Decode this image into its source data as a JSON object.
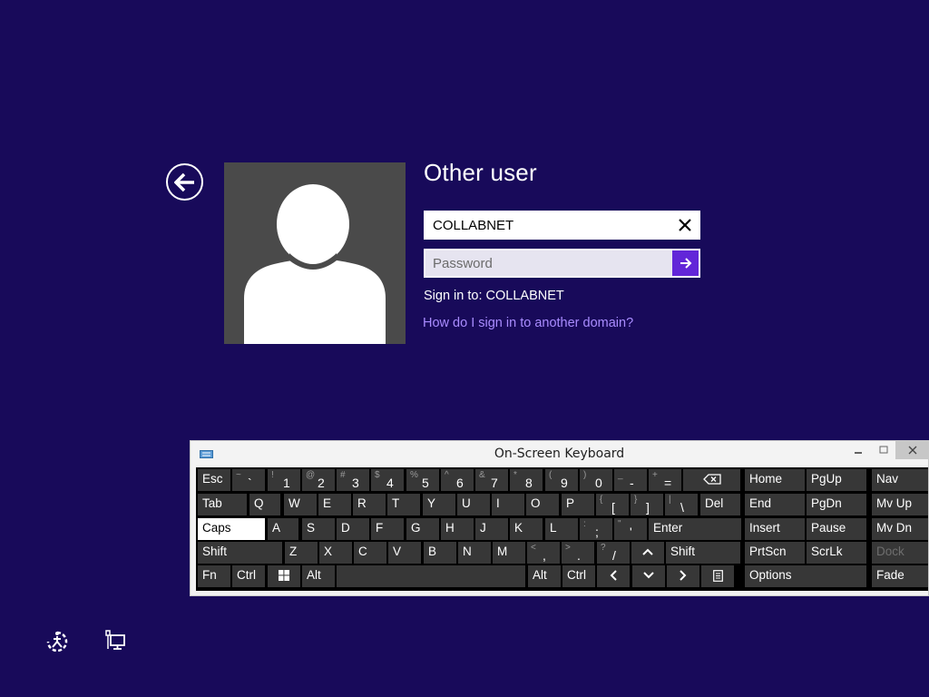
{
  "login": {
    "title": "Other user",
    "username_value": "COLLABNET",
    "password_placeholder": "Password",
    "sign_in_to": "Sign in to: COLLABNET",
    "help_link": "How do I sign in to another domain?"
  },
  "keyboard": {
    "title": "On-Screen Keyboard",
    "rows": [
      [
        {
          "t": "lbl",
          "s": "Esc",
          "name": "esc-key"
        },
        {
          "t": "dual",
          "p": "`",
          "s": "~",
          "name": "backtick-key"
        },
        {
          "t": "dual",
          "p": "1",
          "s": "!",
          "name": "key-1"
        },
        {
          "t": "dual",
          "p": "2",
          "s": "@",
          "name": "key-2"
        },
        {
          "t": "dual",
          "p": "3",
          "s": "#",
          "name": "key-3"
        },
        {
          "t": "dual",
          "p": "4",
          "s": "$",
          "name": "key-4"
        },
        {
          "t": "dual",
          "p": "5",
          "s": "%",
          "name": "key-5"
        },
        {
          "t": "dual",
          "p": "6",
          "s": "^",
          "name": "key-6"
        },
        {
          "t": "dual",
          "p": "7",
          "s": "&",
          "name": "key-7"
        },
        {
          "t": "dual",
          "p": "8",
          "s": "*",
          "name": "key-8"
        },
        {
          "t": "dual",
          "p": "9",
          "s": "(",
          "name": "key-9"
        },
        {
          "t": "dual",
          "p": "0",
          "s": ")",
          "name": "key-0"
        },
        {
          "t": "dual",
          "p": "-",
          "s": "_",
          "name": "minus-key"
        },
        {
          "t": "dual",
          "p": "=",
          "s": "+",
          "name": "equals-key"
        },
        {
          "t": "icon",
          "icon": "backspace",
          "name": "backspace-key"
        },
        {
          "t": "lbl",
          "s": "Home",
          "name": "home-key"
        },
        {
          "t": "lbl",
          "s": "PgUp",
          "name": "pgup-key"
        },
        {
          "t": "lbl",
          "s": "Nav",
          "name": "nav-key"
        }
      ],
      [
        {
          "t": "lbl",
          "s": "Tab",
          "name": "tab-key"
        },
        {
          "t": "lbl",
          "s": "Q",
          "name": "key-q"
        },
        {
          "t": "lbl",
          "s": "W",
          "name": "key-w"
        },
        {
          "t": "lbl",
          "s": "E",
          "name": "key-e"
        },
        {
          "t": "lbl",
          "s": "R",
          "name": "key-r"
        },
        {
          "t": "lbl",
          "s": "T",
          "name": "key-t"
        },
        {
          "t": "lbl",
          "s": "Y",
          "name": "key-y"
        },
        {
          "t": "lbl",
          "s": "U",
          "name": "key-u"
        },
        {
          "t": "lbl",
          "s": "I",
          "name": "key-i"
        },
        {
          "t": "lbl",
          "s": "O",
          "name": "key-o"
        },
        {
          "t": "lbl",
          "s": "P",
          "name": "key-p"
        },
        {
          "t": "dual",
          "p": "[",
          "s": "{",
          "name": "left-bracket-key"
        },
        {
          "t": "dual",
          "p": "]",
          "s": "}",
          "name": "right-bracket-key"
        },
        {
          "t": "dual",
          "p": "\\",
          "s": "|",
          "name": "backslash-key"
        },
        {
          "t": "lbl",
          "s": "Del",
          "name": "del-key"
        },
        {
          "t": "lbl",
          "s": "End",
          "name": "end-key"
        },
        {
          "t": "lbl",
          "s": "PgDn",
          "name": "pgdn-key"
        },
        {
          "t": "lbl",
          "s": "Mv Up",
          "name": "mv-up-key"
        }
      ],
      [
        {
          "t": "lbl",
          "s": "Caps",
          "name": "caps-key",
          "on": true
        },
        {
          "t": "lbl",
          "s": "A",
          "name": "key-a"
        },
        {
          "t": "lbl",
          "s": "S",
          "name": "key-s"
        },
        {
          "t": "lbl",
          "s": "D",
          "name": "key-d"
        },
        {
          "t": "lbl",
          "s": "F",
          "name": "key-f"
        },
        {
          "t": "lbl",
          "s": "G",
          "name": "key-g"
        },
        {
          "t": "lbl",
          "s": "H",
          "name": "key-h"
        },
        {
          "t": "lbl",
          "s": "J",
          "name": "key-j"
        },
        {
          "t": "lbl",
          "s": "K",
          "name": "key-k"
        },
        {
          "t": "lbl",
          "s": "L",
          "name": "key-l"
        },
        {
          "t": "dual",
          "p": ";",
          "s": ":",
          "name": "semicolon-key"
        },
        {
          "t": "dual",
          "p": "'",
          "s": "\"",
          "name": "quote-key"
        },
        {
          "t": "lbl",
          "s": "Enter",
          "name": "enter-key"
        },
        {
          "t": "lbl",
          "s": "Insert",
          "name": "insert-key"
        },
        {
          "t": "lbl",
          "s": "Pause",
          "name": "pause-key"
        },
        {
          "t": "lbl",
          "s": "Mv Dn",
          "name": "mv-dn-key"
        }
      ],
      [
        {
          "t": "lbl",
          "s": "Shift",
          "name": "left-shift-key"
        },
        {
          "t": "lbl",
          "s": "Z",
          "name": "key-z"
        },
        {
          "t": "lbl",
          "s": "X",
          "name": "key-x"
        },
        {
          "t": "lbl",
          "s": "C",
          "name": "key-c"
        },
        {
          "t": "lbl",
          "s": "V",
          "name": "key-v"
        },
        {
          "t": "lbl",
          "s": "B",
          "name": "key-b"
        },
        {
          "t": "lbl",
          "s": "N",
          "name": "key-n"
        },
        {
          "t": "lbl",
          "s": "M",
          "name": "key-m"
        },
        {
          "t": "dual",
          "p": ",",
          "s": "<",
          "name": "comma-key"
        },
        {
          "t": "dual",
          "p": ".",
          "s": ">",
          "name": "period-key"
        },
        {
          "t": "dual",
          "p": "/",
          "s": "?",
          "name": "slash-key"
        },
        {
          "t": "icon",
          "icon": "up",
          "name": "arrow-up-key"
        },
        {
          "t": "lbl",
          "s": "Shift",
          "name": "right-shift-key"
        },
        {
          "t": "lbl",
          "s": "PrtScn",
          "name": "prtscn-key"
        },
        {
          "t": "lbl",
          "s": "ScrLk",
          "name": "scrlk-key"
        },
        {
          "t": "lbl",
          "s": "Dock",
          "name": "dock-key",
          "dim": true
        }
      ],
      [
        {
          "t": "lbl",
          "s": "Fn",
          "name": "fn-key"
        },
        {
          "t": "lbl",
          "s": "Ctrl",
          "name": "left-ctrl-key"
        },
        {
          "t": "icon",
          "icon": "windows",
          "name": "windows-key"
        },
        {
          "t": "lbl",
          "s": "Alt",
          "name": "left-alt-key"
        },
        {
          "t": "lbl",
          "s": "",
          "name": "space-key"
        },
        {
          "t": "lbl",
          "s": "Alt",
          "name": "right-alt-key"
        },
        {
          "t": "lbl",
          "s": "Ctrl",
          "name": "right-ctrl-key"
        },
        {
          "t": "icon",
          "icon": "left",
          "name": "arrow-left-key"
        },
        {
          "t": "icon",
          "icon": "down",
          "name": "arrow-down-key"
        },
        {
          "t": "icon",
          "icon": "right",
          "name": "arrow-right-key"
        },
        {
          "t": "icon",
          "icon": "menu",
          "name": "context-menu-key"
        },
        {
          "t": "lbl",
          "s": "Options",
          "name": "options-key"
        },
        {
          "t": "lbl",
          "s": "Fade",
          "name": "fade-key"
        }
      ]
    ]
  },
  "icons": {
    "back": "back-arrow-icon",
    "clear": "close-icon",
    "submit": "arrow-right-icon",
    "ease_of_access": "ease-of-access-icon",
    "network": "network-icon"
  },
  "colors": {
    "background": "#180a5a",
    "accent": "#6226d8",
    "link": "#a98cff"
  }
}
